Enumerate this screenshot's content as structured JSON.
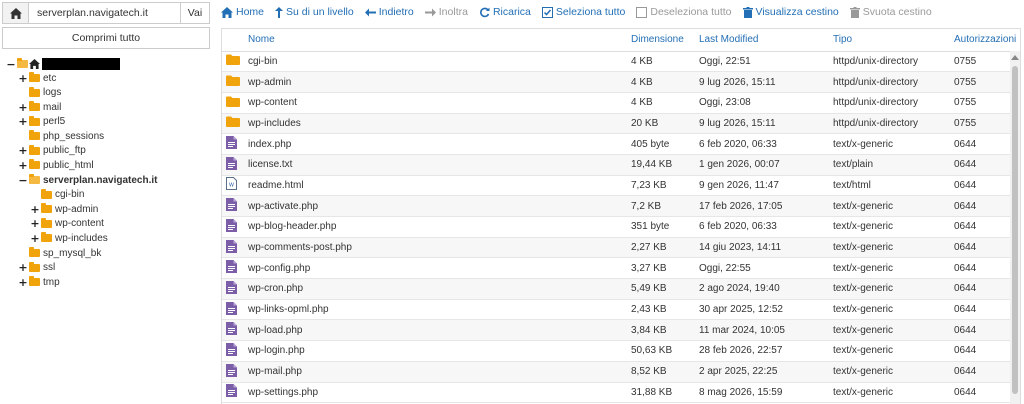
{
  "pathbar": {
    "path": "serverplan.navigatech.it",
    "go_label": "Vai"
  },
  "tree": {
    "collapse_label": "Comprimi tutto",
    "root_icon": "home-icon",
    "items": [
      {
        "label": "etc",
        "toggle": "+"
      },
      {
        "label": "logs",
        "toggle": ""
      },
      {
        "label": "mail",
        "toggle": "+"
      },
      {
        "label": "perl5",
        "toggle": "+"
      },
      {
        "label": "php_sessions",
        "toggle": ""
      },
      {
        "label": "public_ftp",
        "toggle": "+"
      },
      {
        "label": "public_html",
        "toggle": "+"
      },
      {
        "label": "serverplan.navigatech.it",
        "toggle": "−"
      },
      {
        "label": "cgi-bin",
        "toggle": ""
      },
      {
        "label": "wp-admin",
        "toggle": "+"
      },
      {
        "label": "wp-content",
        "toggle": "+"
      },
      {
        "label": "wp-includes",
        "toggle": "+"
      },
      {
        "label": "sp_mysql_bk",
        "toggle": ""
      },
      {
        "label": "ssl",
        "toggle": "+"
      },
      {
        "label": "tmp",
        "toggle": "+"
      }
    ]
  },
  "toolbar": {
    "home": "Home",
    "up": "Su di un livello",
    "back": "Indietro",
    "forward": "Inoltra",
    "reload": "Ricarica",
    "select_all": "Seleziona tutto",
    "deselect_all": "Deseleziona tutto",
    "view_trash": "Visualizza cestino",
    "empty_trash": "Svuota cestino"
  },
  "table": {
    "headers": [
      "Nome",
      "Dimensione",
      "Last Modified",
      "Tipo",
      "Autorizzazioni"
    ],
    "rows": [
      {
        "icon": "folder",
        "name": "cgi-bin",
        "size": "4 KB",
        "modified": "Oggi, 22:51",
        "type": "httpd/unix-directory",
        "perm": "0755"
      },
      {
        "icon": "folder",
        "name": "wp-admin",
        "size": "4 KB",
        "modified": "9 lug 2026, 15:11",
        "type": "httpd/unix-directory",
        "perm": "0755"
      },
      {
        "icon": "folder",
        "name": "wp-content",
        "size": "4 KB",
        "modified": "Oggi, 23:08",
        "type": "httpd/unix-directory",
        "perm": "0755"
      },
      {
        "icon": "folder",
        "name": "wp-includes",
        "size": "20 KB",
        "modified": "9 lug 2026, 15:11",
        "type": "httpd/unix-directory",
        "perm": "0755"
      },
      {
        "icon": "php",
        "name": "index.php",
        "size": "405 byte",
        "modified": "6 feb 2020, 06:33",
        "type": "text/x-generic",
        "perm": "0644"
      },
      {
        "icon": "php",
        "name": "license.txt",
        "size": "19,44 KB",
        "modified": "1 gen 2026, 00:07",
        "type": "text/plain",
        "perm": "0644"
      },
      {
        "icon": "html",
        "name": "readme.html",
        "size": "7,23 KB",
        "modified": "9 gen 2026, 11:47",
        "type": "text/html",
        "perm": "0644"
      },
      {
        "icon": "php",
        "name": "wp-activate.php",
        "size": "7,2 KB",
        "modified": "17 feb 2026, 17:05",
        "type": "text/x-generic",
        "perm": "0644"
      },
      {
        "icon": "php",
        "name": "wp-blog-header.php",
        "size": "351 byte",
        "modified": "6 feb 2020, 06:33",
        "type": "text/x-generic",
        "perm": "0644"
      },
      {
        "icon": "php",
        "name": "wp-comments-post.php",
        "size": "2,27 KB",
        "modified": "14 giu 2023, 14:11",
        "type": "text/x-generic",
        "perm": "0644"
      },
      {
        "icon": "php",
        "name": "wp-config.php",
        "size": "3,27 KB",
        "modified": "Oggi, 22:55",
        "type": "text/x-generic",
        "perm": "0644"
      },
      {
        "icon": "php",
        "name": "wp-cron.php",
        "size": "5,49 KB",
        "modified": "2 ago 2024, 19:40",
        "type": "text/x-generic",
        "perm": "0644"
      },
      {
        "icon": "php",
        "name": "wp-links-opml.php",
        "size": "2,43 KB",
        "modified": "30 apr 2025, 12:52",
        "type": "text/x-generic",
        "perm": "0644"
      },
      {
        "icon": "php",
        "name": "wp-load.php",
        "size": "3,84 KB",
        "modified": "11 mar 2024, 10:05",
        "type": "text/x-generic",
        "perm": "0644"
      },
      {
        "icon": "php",
        "name": "wp-login.php",
        "size": "50,63 KB",
        "modified": "28 feb 2026, 22:57",
        "type": "text/x-generic",
        "perm": "0644"
      },
      {
        "icon": "php",
        "name": "wp-mail.php",
        "size": "8,52 KB",
        "modified": "2 apr 2025, 22:25",
        "type": "text/x-generic",
        "perm": "0644"
      },
      {
        "icon": "php",
        "name": "wp-settings.php",
        "size": "31,88 KB",
        "modified": "8 mag 2026, 15:59",
        "type": "text/x-generic",
        "perm": "0644"
      }
    ]
  },
  "colors": {
    "accent": "#236fb5",
    "folder": "#f0a30a",
    "php_icon": "#7b5ea7"
  }
}
